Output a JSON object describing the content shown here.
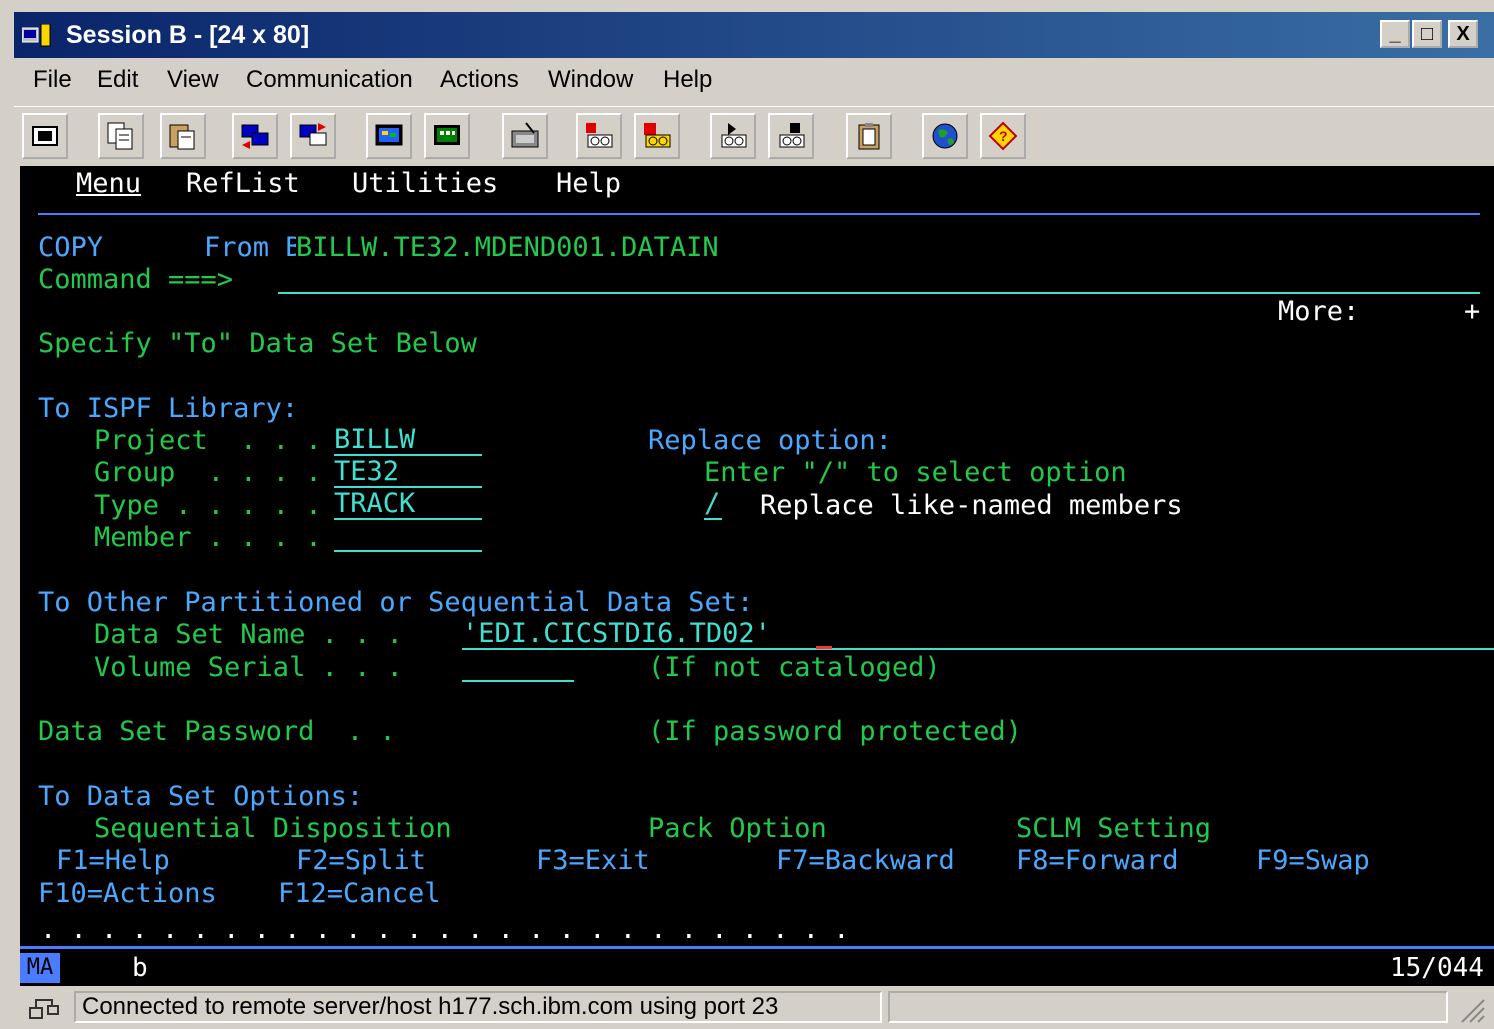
{
  "window": {
    "title": "Session B - [24 x 80]",
    "buttons": {
      "minimize": "_",
      "maximize": "□",
      "close": "X"
    }
  },
  "menubar": {
    "items": [
      "File",
      "Edit",
      "View",
      "Communication",
      "Actions",
      "Window",
      "Help"
    ]
  },
  "toolbar": {
    "icons": [
      "print-screen-icon",
      "copy-icon",
      "paste-icon",
      "send-icon",
      "receive-icon",
      "display-icon",
      "keypad-icon",
      "macro-icon",
      "record-macro-icon",
      "stop-macro-icon",
      "play-macro-icon",
      "stop-play-icon",
      "clipboard-icon",
      "globe-icon",
      "help-icon"
    ]
  },
  "terminal": {
    "action_bar": [
      "Menu",
      "RefList",
      "Utilities",
      "Help"
    ],
    "title_cmd": "COPY",
    "from_text": "From BILLW.TE32.MDEND001.DATAIN",
    "command_label": "Command ===>",
    "command_value": "",
    "more_label": "More:",
    "more_sign": "+",
    "specify_text": "Specify \"To\" Data Set Below",
    "ispf_library_label": "To ISPF Library:",
    "project_label": "Project  . . .",
    "project_value": "BILLW",
    "group_label": "Group  . . . .",
    "group_value": "TE32",
    "type_label": "Type . . . . .",
    "type_value": "TRACK",
    "member_label": "Member . . . .",
    "member_value": "",
    "replace_option_label": "Replace option:",
    "replace_instruction": "Enter \"/\" to select option",
    "replace_check": "/",
    "replace_text": "Replace like-named members",
    "other_ds_label": "To Other Partitioned or Sequential Data Set:",
    "dsn_label": "Data Set Name . . .",
    "dsn_value": "'EDI.CICSTDI6.TD02'",
    "volser_label": "Volume Serial . . .",
    "volser_value": "",
    "volser_note": "(If not cataloged)",
    "password_label": "Data Set Password  . .",
    "password_note": "(If password protected)",
    "options_label": "To Data Set Options:",
    "seq_disp": "Sequential Disposition",
    "pack_option": "Pack Option",
    "sclm_setting": "SCLM Setting",
    "fkeys": [
      "F1=Help",
      "F2=Split",
      "F3=Exit",
      "F7=Backward",
      "F8=Forward",
      "F9=Swap",
      "F10=Actions",
      "F12=Cancel"
    ],
    "dots": ". . . . . . . . . . . . . . . . . . . . . . . . . . ."
  },
  "oia": {
    "mode": "MA",
    "session": "b",
    "cursor_pos": "15/044"
  },
  "statusbar": {
    "message": "Connected to remote server/host h177.sch.ibm.com using port 23"
  }
}
